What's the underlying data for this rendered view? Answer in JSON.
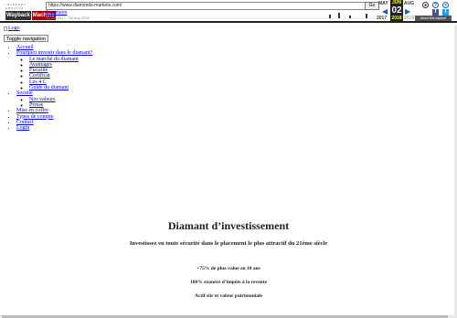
{
  "wayback": {
    "logo_top": "INTERNET ARCHIVE",
    "logo_parts": [
      "Wayback",
      "Machine"
    ],
    "url": "https://www.diamonds-markets.com/",
    "go_label": "Go",
    "captures": "6 captures",
    "range": "11 Jan 2017 - 08 Aug 2019",
    "prev_month": "MAY",
    "cur_month": "JUN",
    "next_month": "AUG",
    "cur_day": "02",
    "prev_year": "2017",
    "cur_year": "2018",
    "next_year": "2019",
    "about_label": "About this capture"
  },
  "page": {
    "logo_alt": "Logo",
    "toggle_label": "Toggle navigation",
    "nav": [
      {
        "label": "Accueil"
      },
      {
        "label": "Pourquoi investir dans le diamant?",
        "children": [
          "Le marché du diamant",
          "Avantages",
          "Fiscalité",
          "Certificat",
          "Les 4 C",
          "Guide du diamant"
        ]
      },
      {
        "label": "Société",
        "children": [
          "Nos valeurs",
          "Presse"
        ]
      },
      {
        "label": "Mise en coffre"
      },
      {
        "label": "Types de compte"
      },
      {
        "label": "Contact"
      },
      {
        "label": "Login"
      }
    ],
    "hero": {
      "title": "Diamant d’investissement",
      "subtitle": "Investissez en toute sécurité dans le placement le plus attractif du 21ème siècle",
      "points": [
        "+75% de plus-value en 10 ans",
        "100% exonéré d’impôts à la revente",
        "Actif sûr et valeur patrimoniale"
      ]
    }
  }
}
